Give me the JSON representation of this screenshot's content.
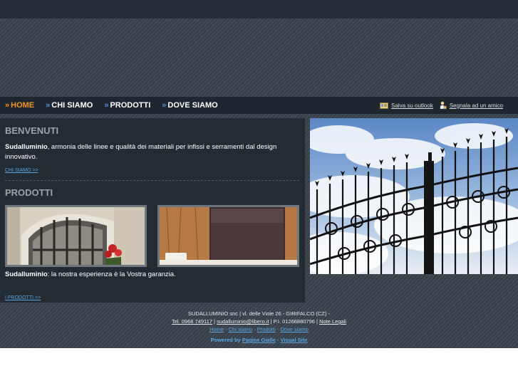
{
  "nav": {
    "items": [
      {
        "label": "HOME",
        "active": true
      },
      {
        "label": "CHI SIAMO",
        "active": false
      },
      {
        "label": "PRODOTTI",
        "active": false
      },
      {
        "label": "DOVE SIAMO",
        "active": false
      }
    ],
    "arrow": "»",
    "tools": {
      "outlook": "Salva su outlook",
      "friend": "Segnala ad un amico"
    }
  },
  "welcome": {
    "heading": "BENVENUTI",
    "brand": "Sudalluminio",
    "text": ", armonia delle linee e qualità dei materiali per infissi e serramenti dal design innovativo.",
    "link": "CHI SIAMO >>"
  },
  "products": {
    "heading": "PRODOTTI",
    "brand": "Sudalluminio",
    "text": ": la nostra esperienza è la Vostra garanzia.",
    "link": "I PRODOTTI >>"
  },
  "footer": {
    "company": "SUDALLUMINIO snc | vl. delle Viole 26 - GIRIFALCO (CZ) -",
    "tel": "Tel. 0968 749117",
    "sep1": " | ",
    "email": "sudalluminio@libero.it",
    "piva": " | P.I. 01266880796 | ",
    "legal": "Note Legali",
    "links": [
      "Home",
      "Chi siamo",
      "Prodotti",
      "Dove siamo"
    ],
    "link_sep": " - ",
    "powered_label": "Powered by",
    "powered_link1": "Pagine Gialle",
    "powered_dash": " - ",
    "powered_link2": "Visual Site"
  },
  "colors": {
    "accent_orange": "#f39220",
    "link_blue": "#5aa7e3",
    "nav_bg": "#1e272f",
    "content_bg": "#232c33"
  }
}
